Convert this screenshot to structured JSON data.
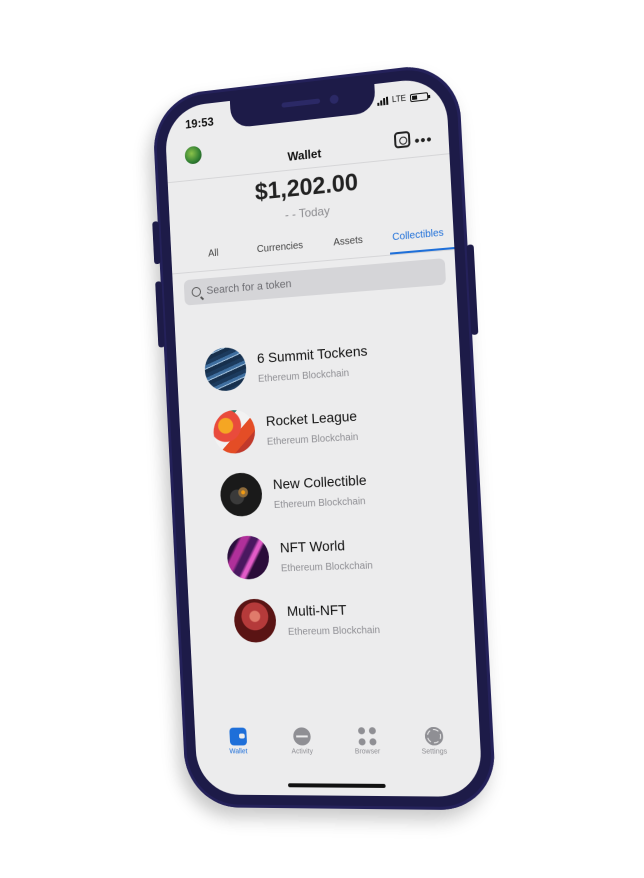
{
  "status_bar": {
    "time": "19:53",
    "network": "LTE"
  },
  "header": {
    "title": "Wallet"
  },
  "balance": {
    "amount": "$1,202.00",
    "change": "- - Today"
  },
  "tabs": [
    {
      "label": "All"
    },
    {
      "label": "Currencies"
    },
    {
      "label": "Assets"
    },
    {
      "label": "Collectibles",
      "active": true
    }
  ],
  "search": {
    "placeholder": "Search for a token"
  },
  "collectibles": [
    {
      "title": "6 Summit Tockens",
      "subtitle": "Ethereum Blockchain"
    },
    {
      "title": "Rocket League",
      "subtitle": "Ethereum Blockchain"
    },
    {
      "title": "New Collectible",
      "subtitle": "Ethereum Blockchain"
    },
    {
      "title": "NFT World",
      "subtitle": "Ethereum Blockchain"
    },
    {
      "title": "Multi-NFT",
      "subtitle": "Ethereum Blockchain"
    }
  ],
  "bottom_nav": [
    {
      "label": "Wallet",
      "icon": "wallet-icon",
      "active": true
    },
    {
      "label": "Activity",
      "icon": "activity-icon"
    },
    {
      "label": "Browser",
      "icon": "browser-icon"
    },
    {
      "label": "Settings",
      "icon": "gear-icon"
    }
  ],
  "colors": {
    "accent": "#1e6fd9",
    "frame": "#1d1b48",
    "screen_bg": "#ececed"
  }
}
